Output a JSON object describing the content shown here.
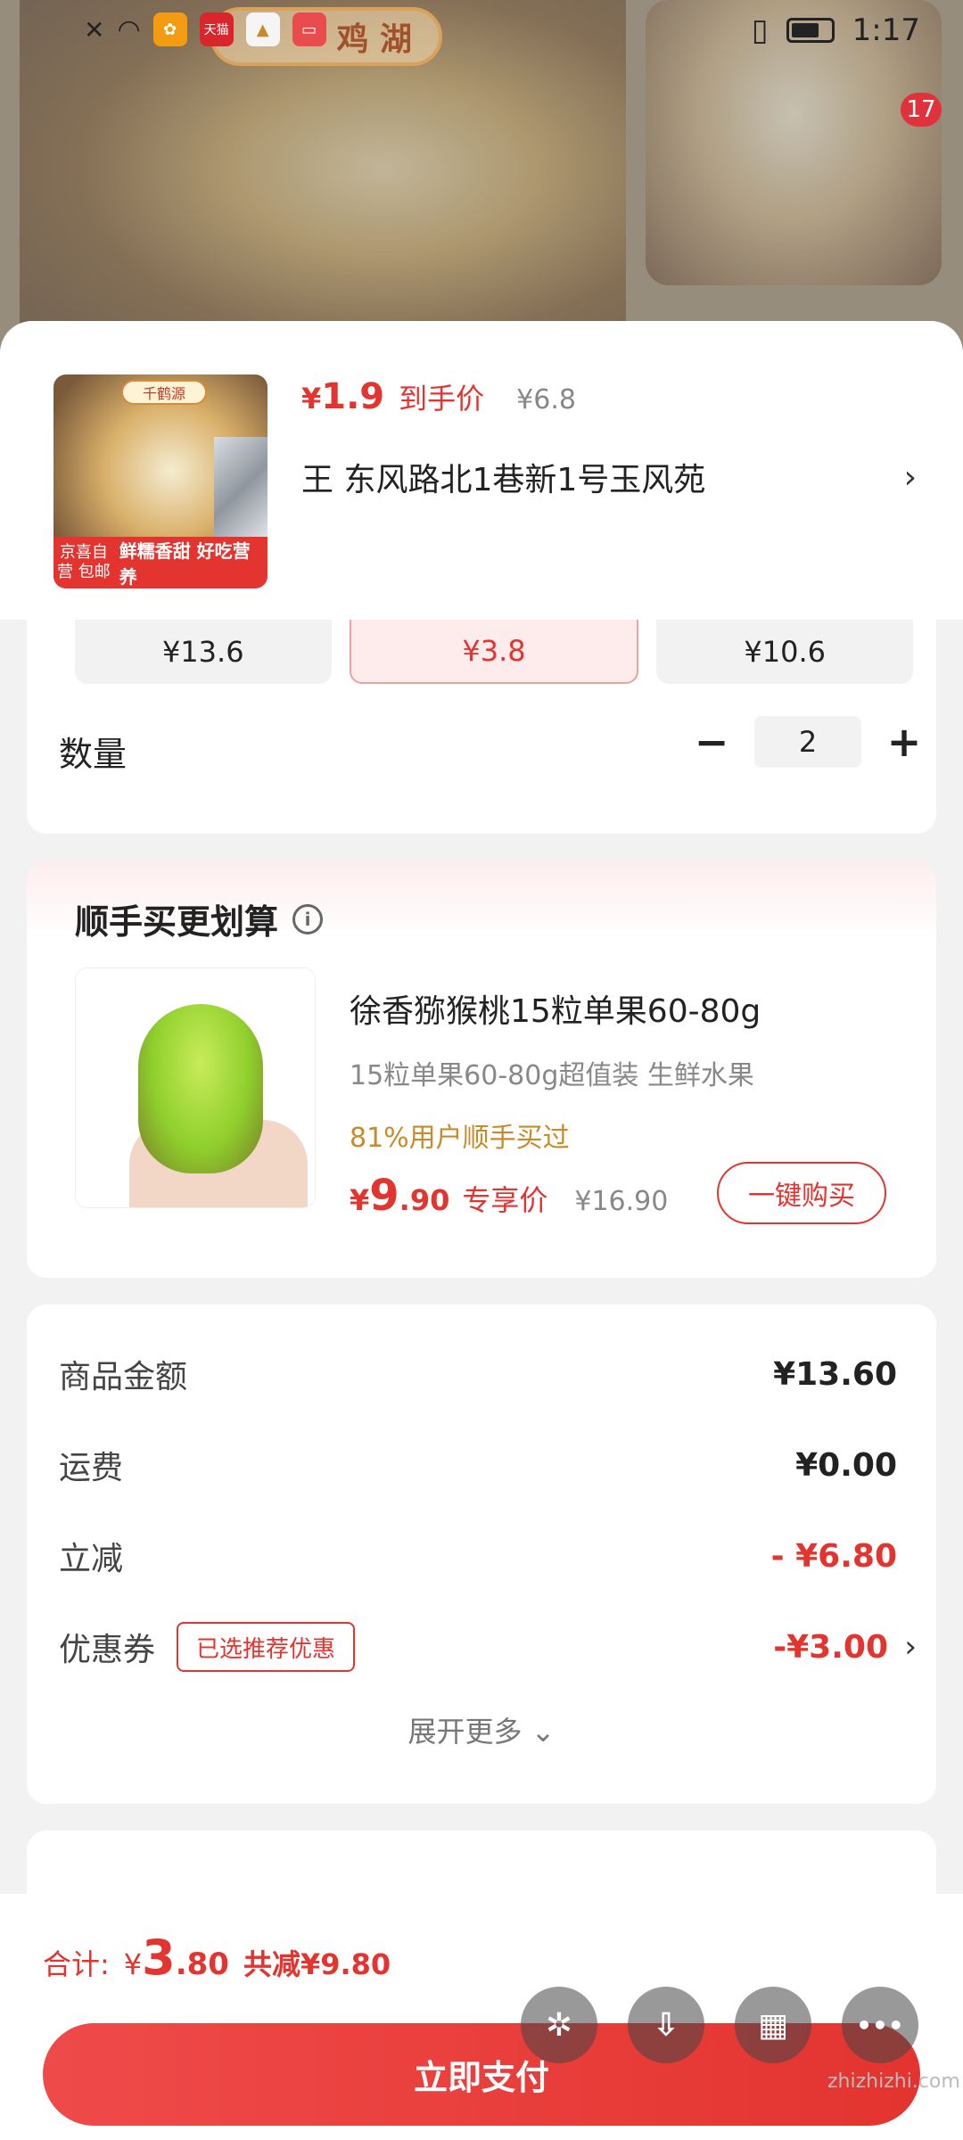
{
  "status_bar": {
    "time": "1:17",
    "apps": [
      {
        "name": "app-icon",
        "color": "#f39c12"
      },
      {
        "name": "tmall-icon",
        "label": "天猫",
        "color": "#d9262d"
      },
      {
        "name": "app-icon-2",
        "color": "#f0c419"
      },
      {
        "name": "app-icon-3",
        "color": "#e94c4c"
      }
    ]
  },
  "background": {
    "banner_text": "鸡 湖",
    "cart_badge": "17"
  },
  "product": {
    "thumb_tag": "千鹤源",
    "thumb_strip_a": "京喜自营 包邮",
    "thumb_strip_b": "鲜糯香甜 好吃营养",
    "price_symbol": "¥",
    "price_value": "1.9",
    "price_tag": "到手价",
    "original_price": "¥6.8",
    "close_icon": "×",
    "address": "王  东风路北1巷新1号玉风苑",
    "address_chevron": "›"
  },
  "specs": [
    {
      "price": "¥13.6",
      "selected": false
    },
    {
      "price": "¥3.8",
      "selected": true
    },
    {
      "price": "¥10.6",
      "selected": false
    }
  ],
  "quantity": {
    "label": "数量",
    "minus": "−",
    "value": "2",
    "plus": "+"
  },
  "upsell": {
    "title": "顺手买更划算",
    "info_icon": "i",
    "name": "徐香猕猴桃15粒单果60-80g",
    "desc": "15粒单果60-80g超值装    生鲜水果",
    "users": "81%用户顺手买过",
    "price_symbol": "¥",
    "price_int": "9",
    "price_dec": ".90",
    "price_tag": "专享价",
    "original_price": "¥16.90",
    "buy_button": "一键购买"
  },
  "summary": {
    "rows": [
      {
        "label": "商品金额",
        "value": "¥13.60"
      },
      {
        "label": "运费",
        "value": "¥0.00"
      },
      {
        "label": "立减",
        "value": "- ¥6.80"
      },
      {
        "label": "优惠券",
        "value": "-¥3.00"
      }
    ],
    "coupon_tag": "已选推荐优惠",
    "coupon_chevron": "›",
    "expand_label": "展开更多 ⌄"
  },
  "bottom": {
    "total_label": "合计:",
    "total_symbol": "¥",
    "total_int": "3",
    "total_dec": ".80",
    "total_saved": "共减¥9.80",
    "pay_button": "立即支付"
  },
  "floating_buttons": [
    {
      "name": "sparkle-icon",
      "glyph": "✲"
    },
    {
      "name": "download-icon",
      "glyph": "⇩"
    },
    {
      "name": "grid-icon",
      "glyph": "▦"
    },
    {
      "name": "more-icon",
      "glyph": "•••"
    }
  ],
  "watermark": "zhizhizhi.com",
  "colors": {
    "accent": "#e3342f",
    "gold": "#c98a2a"
  }
}
